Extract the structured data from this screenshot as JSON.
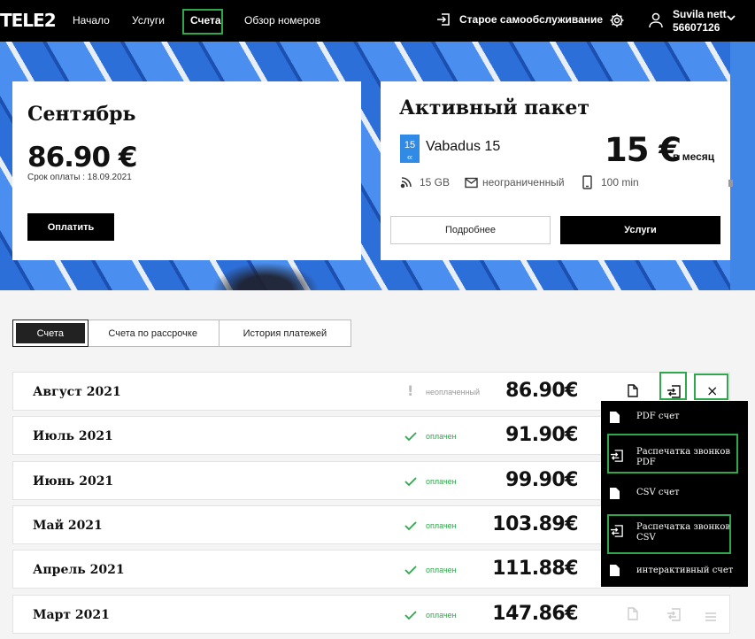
{
  "header": {
    "logo": "TELE2",
    "nav": [
      "Начало",
      "Услуги",
      "Счета",
      "Обзор номеров"
    ],
    "self_service": "Старое самообслуживание",
    "user_name": "Suvila nett",
    "user_number": "56607126"
  },
  "bill_card": {
    "month": "Сентябрь",
    "amount": "86.90 €",
    "due": "Срок оплаты : 18.09.2021",
    "pay_label": "Оплатить"
  },
  "package_card": {
    "title": "Активный пакет",
    "badge_num": "15",
    "badge_sub": "€€",
    "name": "Vabadus 15",
    "price": "15 €",
    "per": "в месяц",
    "data": "15 GB",
    "sms": "неограниченный",
    "minutes": "100 min",
    "more_label": "Подробнее",
    "services_label": "Услуги"
  },
  "tabs": [
    "Счета",
    "Счета по рассрочке",
    "История платежей"
  ],
  "invoices": [
    {
      "month": "Август 2021",
      "status": "неоплаченный",
      "amount": "86.90€"
    },
    {
      "month": "Июль 2021",
      "status": "оплачен",
      "amount": "91.90€"
    },
    {
      "month": "Июнь 2021",
      "status": "оплачен",
      "amount": "99.90€"
    },
    {
      "month": "Май 2021",
      "status": "оплачен",
      "amount": "103.89€"
    },
    {
      "month": "Апрель 2021",
      "status": "оплачен",
      "amount": "111.88€"
    },
    {
      "month": "Март 2021",
      "status": "оплачен",
      "amount": "147.86€"
    }
  ],
  "menu": {
    "close": "×",
    "items": [
      "PDF счет",
      "Распечатка звонков PDF",
      "CSV счет",
      "Распечатка звонков CSV",
      "интерактивный счет"
    ]
  },
  "colors": {
    "highlight": "#2ea84a",
    "accent": "#2f8be6"
  }
}
